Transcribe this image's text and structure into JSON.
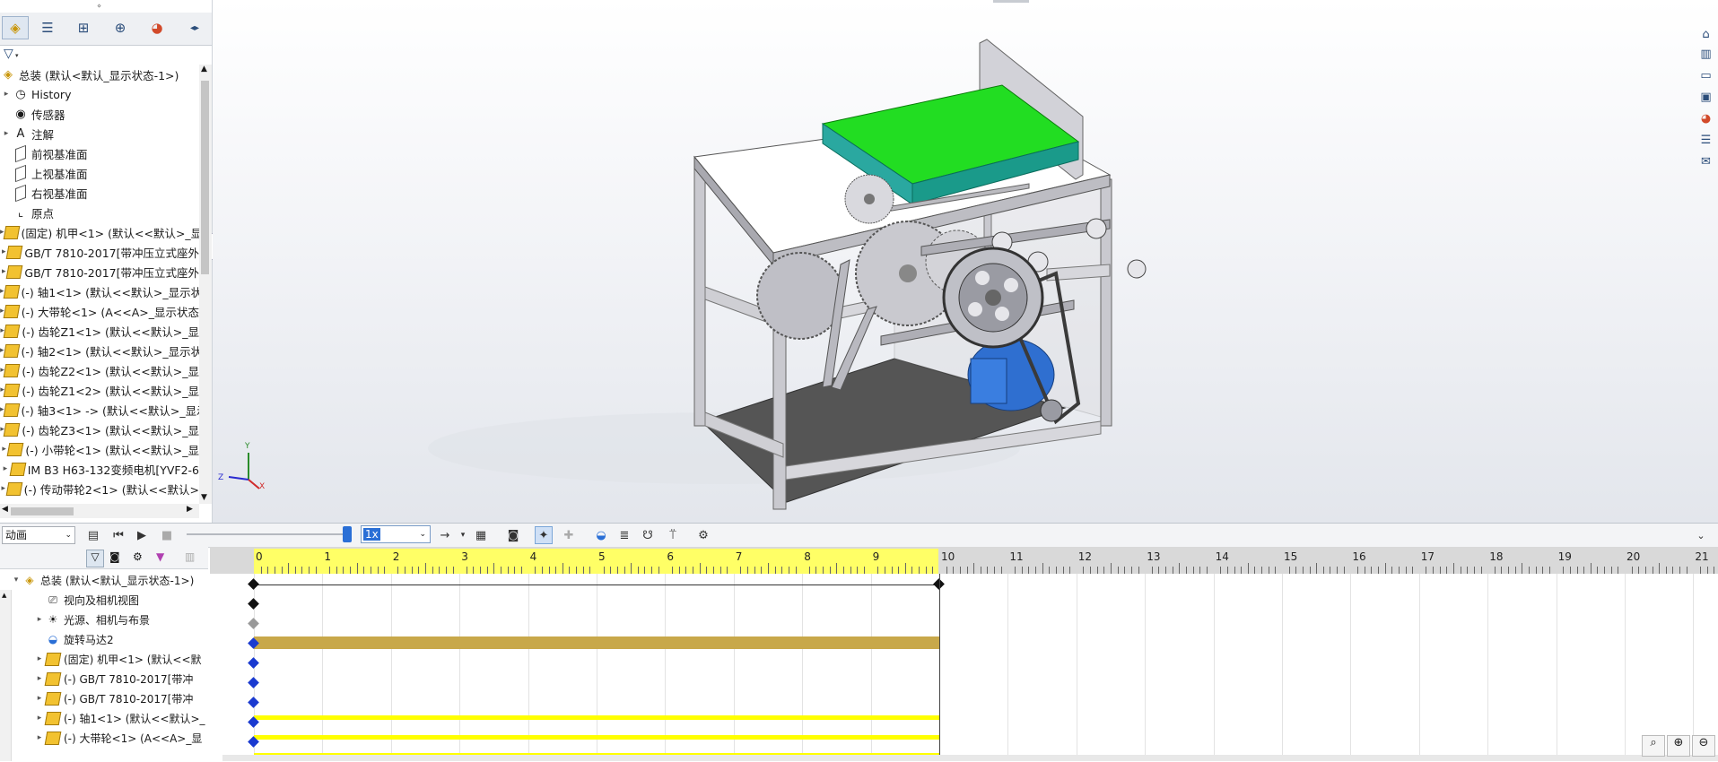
{
  "feature_manager": {
    "tabs": [
      {
        "name": "featuremanager-tab",
        "icon": "assembly-icon"
      },
      {
        "name": "propertymanager-tab",
        "icon": "property-icon"
      },
      {
        "name": "configurationmanager-tab",
        "icon": "configuration-icon"
      },
      {
        "name": "dimxpert-tab",
        "icon": "crosshair-icon"
      },
      {
        "name": "display-manager-tab",
        "icon": "appearance-icon"
      }
    ],
    "tree_root": "总装  (默认<默认_显示状态-1>)",
    "tree_items": [
      {
        "label": "History",
        "icon": "history-icon",
        "expand": "▸"
      },
      {
        "label": "传感器",
        "icon": "sensor-icon",
        "expand": ""
      },
      {
        "label": "注解",
        "icon": "annotation-icon",
        "expand": "▸"
      },
      {
        "label": "前视基准面",
        "icon": "plane-icon",
        "expand": ""
      },
      {
        "label": "上视基准面",
        "icon": "plane-icon",
        "expand": ""
      },
      {
        "label": "右视基准面",
        "icon": "plane-icon",
        "expand": ""
      },
      {
        "label": "原点",
        "icon": "origin-icon",
        "expand": ""
      },
      {
        "label": "(固定) 机甲<1> (默认<<默认>_显",
        "icon": "part-icon",
        "expand": "▸"
      },
      {
        "label": "GB/T 7810-2017[带冲压立式座外",
        "icon": "part-icon",
        "expand": "▸"
      },
      {
        "label": "GB/T 7810-2017[带冲压立式座外",
        "icon": "part-icon",
        "expand": "▸"
      },
      {
        "label": "(-) 轴1<1> (默认<<默认>_显示状",
        "icon": "part-icon",
        "expand": "▸"
      },
      {
        "label": "(-) 大带轮<1> (A<<A>_显示状态",
        "icon": "part-icon",
        "expand": "▸"
      },
      {
        "label": "(-) 齿轮Z1<1> (默认<<默认>_显",
        "icon": "part-icon",
        "expand": "▸"
      },
      {
        "label": "(-) 轴2<1> (默认<<默认>_显示状",
        "icon": "part-icon",
        "expand": "▸"
      },
      {
        "label": "(-) 齿轮Z2<1> (默认<<默认>_显",
        "icon": "part-icon",
        "expand": "▸"
      },
      {
        "label": "(-) 齿轮Z1<2> (默认<<默认>_显",
        "icon": "part-icon",
        "expand": "▸"
      },
      {
        "label": "(-) 轴3<1> -> (默认<<默认>_显示",
        "icon": "part-icon",
        "expand": "▸"
      },
      {
        "label": "(-) 齿轮Z3<1> (默认<<默认>_显",
        "icon": "part-icon",
        "expand": "▸"
      },
      {
        "label": "(-) 小带轮<1> (默认<<默认>_显",
        "icon": "part-icon",
        "expand": "▸"
      },
      {
        "label": "IM B3 H63-132变频电机[YVF2-6",
        "icon": "part-icon",
        "expand": "▸"
      },
      {
        "label": "(-) 传动带轮2<1> (默认<<默认>",
        "icon": "part-icon",
        "expand": "▸"
      }
    ]
  },
  "motion_manager": {
    "study_type": "动画",
    "speed": "1x",
    "root": "总装  (默认<默认_显示状态-1>)",
    "items": [
      {
        "label": "视向及相机视图",
        "icon": "camera-view-icon",
        "expand": ""
      },
      {
        "label": "光源、相机与布景",
        "icon": "lights-icon",
        "expand": "▸"
      },
      {
        "label": "旋转马达2",
        "icon": "motor-icon",
        "expand": ""
      },
      {
        "label": "(固定) 机甲<1> (默认<<默",
        "icon": "part-icon",
        "expand": "▸"
      },
      {
        "label": "(-) GB/T 7810-2017[带冲",
        "icon": "part-icon",
        "expand": "▸"
      },
      {
        "label": "(-) GB/T 7810-2017[带冲",
        "icon": "part-icon",
        "expand": "▸"
      },
      {
        "label": "(-) 轴1<1> (默认<<默认>_",
        "icon": "part-icon",
        "expand": "▸"
      },
      {
        "label": "(-) 大带轮<1> (A<<A>_显",
        "icon": "part-icon",
        "expand": "▸"
      }
    ],
    "timeline_ticks": [
      "0 秒",
      "1 秒",
      "2 秒",
      "3 秒",
      "4 秒",
      "5 秒",
      "6 秒",
      "7 秒",
      "8 秒",
      "9 秒",
      "10 秒",
      "11 秒",
      "12 秒",
      "13 秒",
      "14 秒",
      "15 秒",
      "16 秒",
      "17 秒",
      "18 秒",
      "19 秒",
      "20 秒",
      "21 秒"
    ],
    "tick_display": [
      "0",
      "1",
      "2",
      "3",
      "4",
      "5",
      "6",
      "7",
      "8",
      "9",
      "10",
      "11",
      "12",
      "13",
      "14",
      "15",
      "16",
      "17",
      "18",
      "19",
      "20",
      "21"
    ],
    "duration_seconds": 10
  },
  "colors": {
    "accent": "#2a6fd6",
    "conveyor": "#22dd22",
    "motor": "#2f6fd0",
    "timeline_motor_bar": "#c8a84a",
    "timeline_yellow": "#ffff00"
  }
}
